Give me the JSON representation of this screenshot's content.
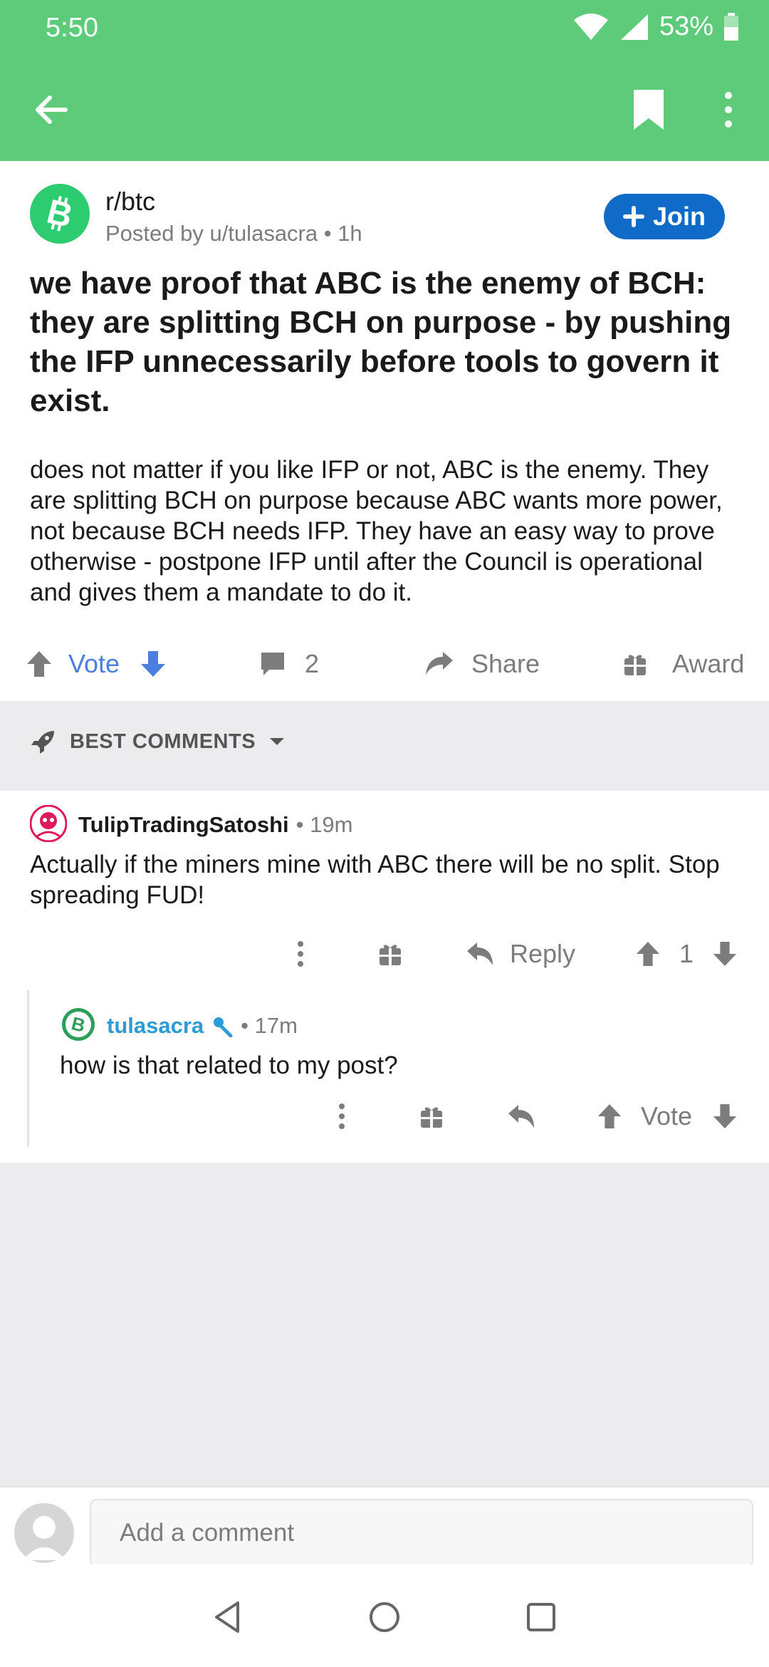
{
  "status_bar": {
    "time": "5:50",
    "battery": "53%"
  },
  "subreddit": {
    "name": "r/btc",
    "posted_by": "Posted by u/tulasacra • 1h",
    "join_label": "Join"
  },
  "post": {
    "title": "we have proof that ABC is the enemy of BCH: they are splitting BCH on purpose - by pushing the IFP unnecessarily before tools to govern it exist.",
    "body": "does not matter if you like IFP or not, ABC is the enemy. They are splitting BCH on purpose because ABC wants more power, not because BCH needs IFP. They have an easy way to prove otherwise - postpone IFP until after the Council is operational and gives them a mandate to do it."
  },
  "actions": {
    "vote_label": "Vote",
    "comment_count": "2",
    "share_label": "Share",
    "award_label": "Award"
  },
  "sort": {
    "label": "BEST COMMENTS"
  },
  "comments": [
    {
      "author": "TulipTradingSatoshi",
      "time": "• 19m",
      "body": "Actually if the miners mine with ABC there will be no split. Stop spreading FUD!",
      "reply_label": "Reply",
      "score": "1"
    },
    {
      "author": "tulasacra",
      "time": "• 17m",
      "body": "how is that related to my post?",
      "vote_label": "Vote"
    }
  ],
  "add_comment": {
    "placeholder": "Add a comment"
  },
  "colors": {
    "header_green": "#5ECB7A",
    "join_blue": "#0F6BC7",
    "vote_blue": "#4A7FE0",
    "op_blue": "#2E9BD6"
  }
}
